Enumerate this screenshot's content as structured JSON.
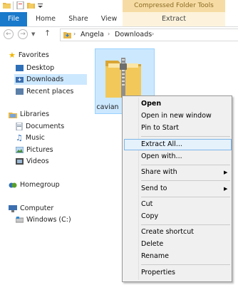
{
  "contextual_tab": "Compressed Folder Tools",
  "ribbon_tabs": [
    "File",
    "Home",
    "Share",
    "View",
    "Extract"
  ],
  "breadcrumb": [
    "Angela",
    "Downloads"
  ],
  "sidebar": {
    "favorites": "Favorites",
    "favorites_items": [
      "Desktop",
      "Downloads",
      "Recent places"
    ],
    "libraries": "Libraries",
    "libraries_items": [
      "Documents",
      "Music",
      "Pictures",
      "Videos"
    ],
    "homegroup": "Homegroup",
    "computer": "Computer",
    "computer_items": [
      "Windows (C:)"
    ]
  },
  "file": {
    "label": "cavian"
  },
  "context_menu": {
    "items": [
      "Open",
      "Open in new window",
      "Pin to Start",
      "Extract All...",
      "Open with...",
      "Share with",
      "Send to",
      "Cut",
      "Copy",
      "Create shortcut",
      "Delete",
      "Rename",
      "Properties"
    ]
  },
  "colors": {
    "accent": "#1979ca",
    "selection": "#cce8ff",
    "contextual": "#f6dca4"
  }
}
